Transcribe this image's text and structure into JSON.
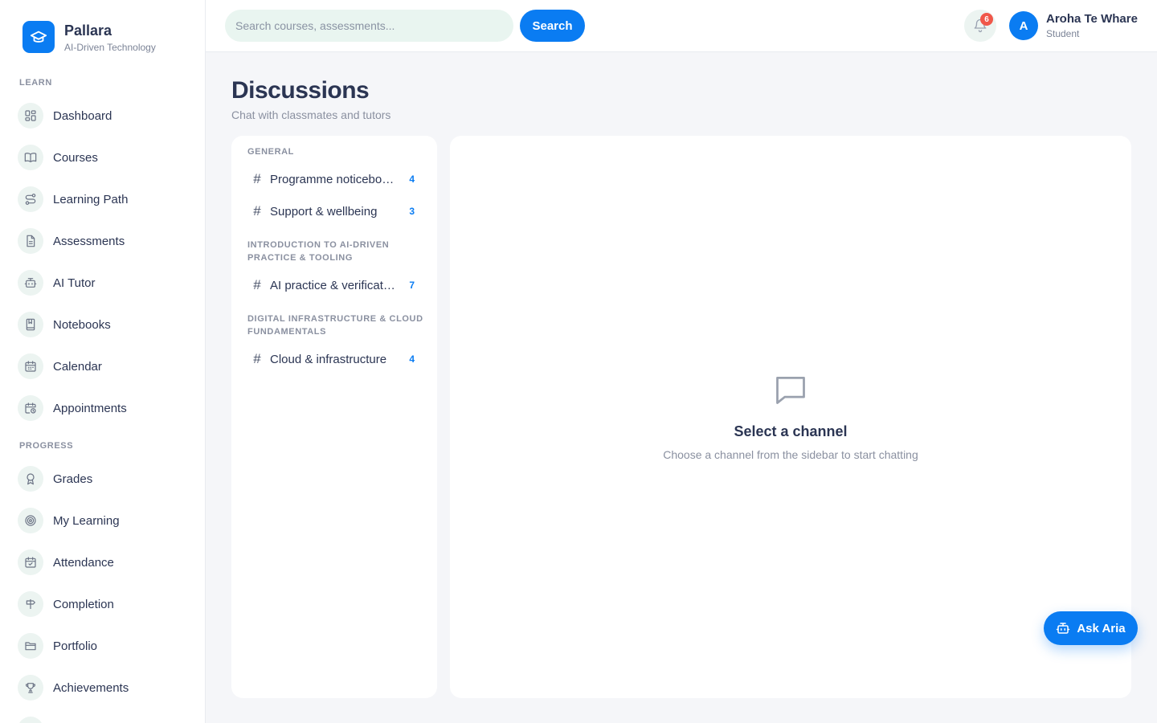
{
  "brand": {
    "name": "Pallara",
    "subtitle": "AI-Driven Technology"
  },
  "sidebar": {
    "sections": [
      {
        "title": "LEARN",
        "items": [
          {
            "label": "Dashboard",
            "icon": "dashboard-icon"
          },
          {
            "label": "Courses",
            "icon": "book-icon"
          },
          {
            "label": "Learning Path",
            "icon": "route-icon"
          },
          {
            "label": "Assessments",
            "icon": "document-icon"
          },
          {
            "label": "AI Tutor",
            "icon": "bot-icon"
          },
          {
            "label": "Notebooks",
            "icon": "notebook-icon"
          },
          {
            "label": "Calendar",
            "icon": "calendar-icon"
          },
          {
            "label": "Appointments",
            "icon": "calendar-clock-icon"
          }
        ]
      },
      {
        "title": "PROGRESS",
        "items": [
          {
            "label": "Grades",
            "icon": "award-icon"
          },
          {
            "label": "My Learning",
            "icon": "target-icon"
          },
          {
            "label": "Attendance",
            "icon": "calendar-check-icon"
          },
          {
            "label": "Completion",
            "icon": "signpost-icon"
          },
          {
            "label": "Portfolio",
            "icon": "folder-icon"
          },
          {
            "label": "Achievements",
            "icon": "trophy-icon"
          }
        ]
      }
    ]
  },
  "topbar": {
    "search_placeholder": "Search courses, assessments...",
    "search_label": "Search",
    "notification_count": "6",
    "user": {
      "initial": "A",
      "name": "Aroha Te Whare",
      "role": "Student"
    }
  },
  "page": {
    "title": "Discussions",
    "subtitle": "Chat with classmates and tutors"
  },
  "channels": {
    "groups": [
      {
        "title": "GENERAL",
        "channels": [
          {
            "name": "Programme noticeboard",
            "count": "4"
          },
          {
            "name": "Support & wellbeing",
            "count": "3"
          }
        ]
      },
      {
        "title": "INTRODUCTION TO AI-DRIVEN PRACTICE & TOOLING",
        "channels": [
          {
            "name": "AI practice & verification",
            "count": "7"
          }
        ]
      },
      {
        "title": "DIGITAL INFRASTRUCTURE & CLOUD FUNDAMENTALS",
        "channels": [
          {
            "name": "Cloud & infrastructure",
            "count": "4"
          }
        ]
      }
    ]
  },
  "empty_state": {
    "icon": "message-square-icon",
    "title": "Select a channel",
    "subtitle": "Choose a channel from the sidebar to start chatting"
  },
  "assistant": {
    "label": "Ask Aria",
    "icon": "bot-icon"
  },
  "colors": {
    "primary": "#0a7cf2",
    "badge": "#f0574a",
    "icon_bg": "#ecf4f1"
  }
}
